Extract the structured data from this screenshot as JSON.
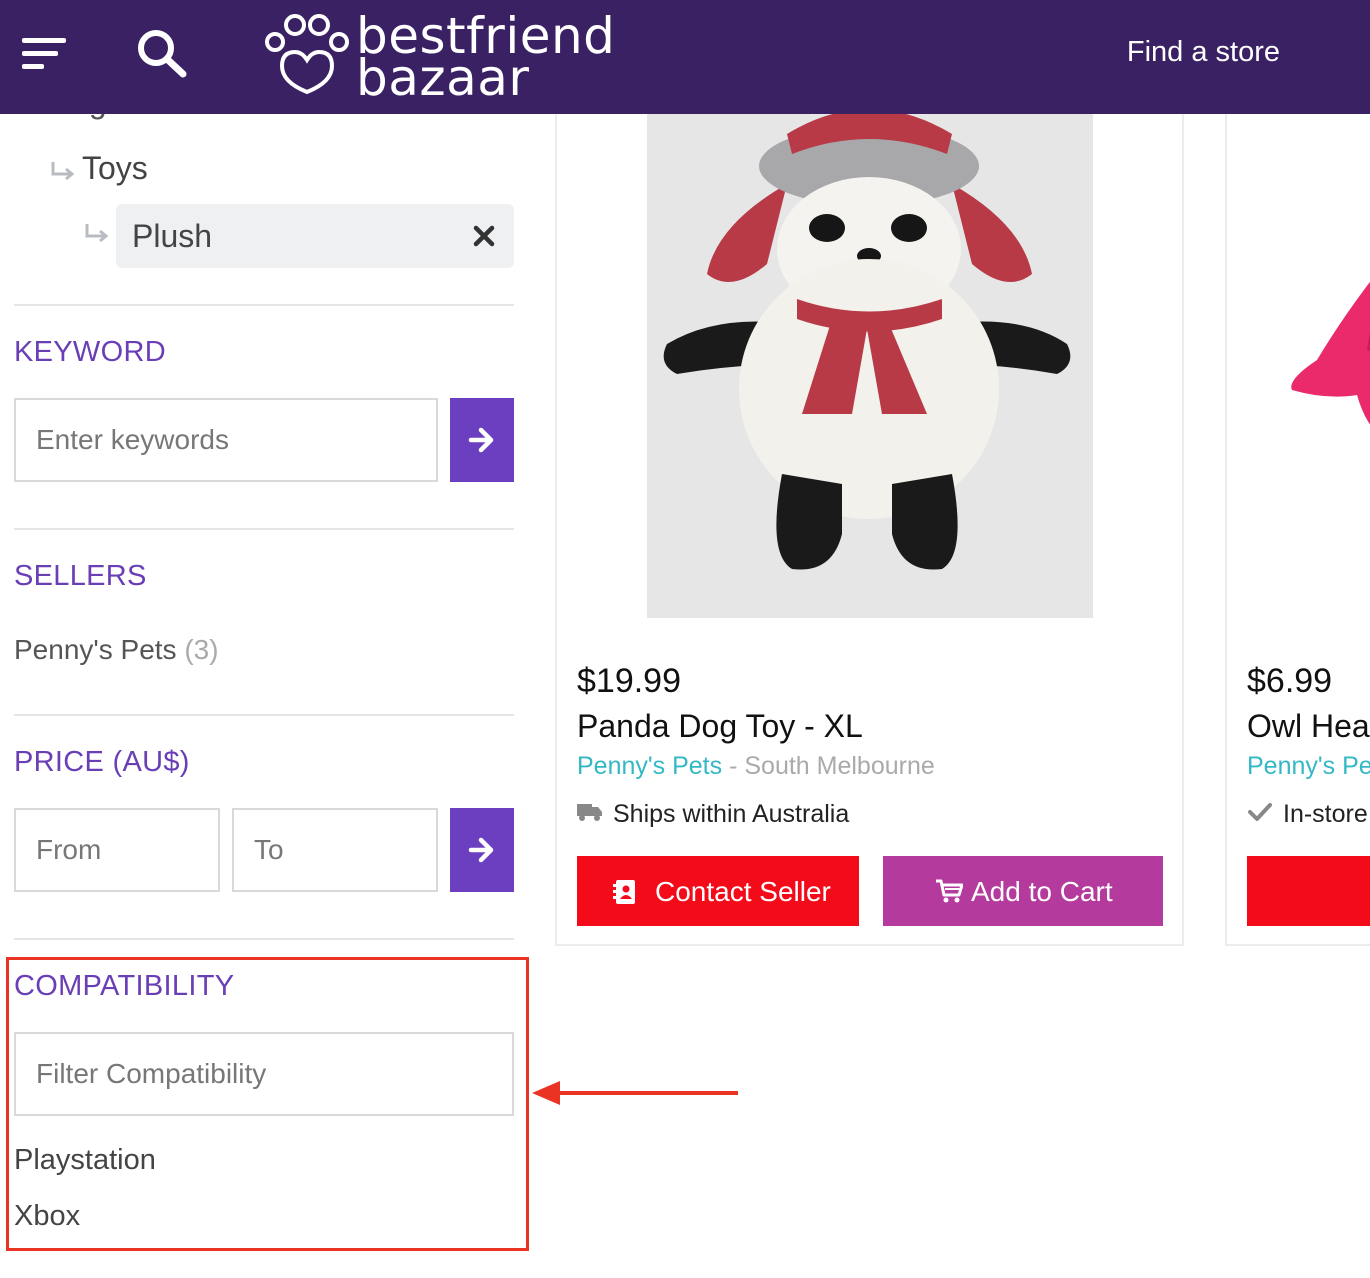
{
  "header": {
    "logo_line1": "bestfriend",
    "logo_line2": "bazaar",
    "find_store": "Find a store"
  },
  "categories": {
    "parent": "Dogs",
    "child": "Toys",
    "active": "Plush"
  },
  "keyword": {
    "title": "KEYWORD",
    "placeholder": "Enter keywords"
  },
  "sellers": {
    "title": "SELLERS",
    "items": [
      {
        "name": "Penny's Pets",
        "count": "(3)"
      }
    ]
  },
  "price": {
    "title": "PRICE (AU$)",
    "from_placeholder": "From",
    "to_placeholder": "To"
  },
  "compatibility": {
    "title": "COMPATIBILITY",
    "placeholder": "Filter Compatibility",
    "options": [
      "Playstation",
      "Xbox"
    ]
  },
  "products": [
    {
      "price": "$19.99",
      "name": "Panda Dog Toy - XL",
      "seller": "Penny's Pets",
      "location": "- South Melbourne",
      "shipping": "Ships within Australia",
      "contact_label": "Contact Seller",
      "cart_label": "Add to Cart"
    },
    {
      "price": "$6.99",
      "name": "Owl Hea",
      "seller": "Penny's Pet",
      "shipping": "In-store"
    }
  ],
  "colors": {
    "header_bg": "#3a2163",
    "accent_purple": "#6b3fbf",
    "contact_red": "#f30b1a",
    "cart_magenta": "#b53a9e",
    "seller_teal": "#34b8c4",
    "annotation_red": "#ea3323"
  }
}
